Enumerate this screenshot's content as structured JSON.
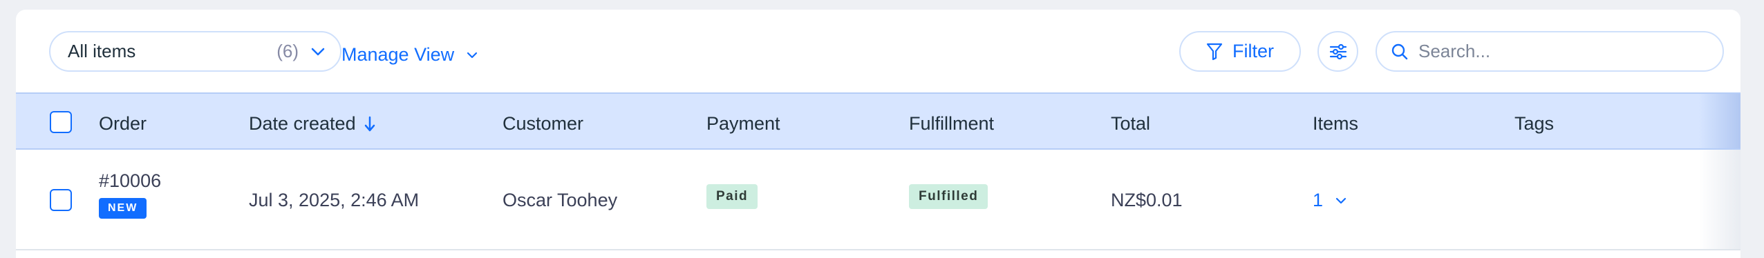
{
  "toolbar": {
    "view_select": {
      "label": "All items",
      "count": "(6)"
    },
    "manage_view_label": "Manage View",
    "filter_label": "Filter",
    "search": {
      "placeholder": "Search...",
      "value": ""
    }
  },
  "table": {
    "columns": [
      "Order",
      "Date created",
      "Customer",
      "Payment",
      "Fulfillment",
      "Total",
      "Items",
      "Tags"
    ],
    "sorted_column": "Date created",
    "sort_direction": "descending",
    "rows": [
      {
        "order": "#10006",
        "badge": "NEW",
        "date_created": "Jul 3, 2025, 2:46 AM",
        "customer": "Oscar Toohey",
        "payment": "Paid",
        "fulfillment": "Fulfilled",
        "total": "NZ$0.01",
        "items": "1",
        "tags": ""
      }
    ]
  },
  "colors": {
    "accent": "#116dff",
    "header_bg": "#d7e5ff",
    "badge_green": "#cdeee0",
    "page_bg": "#eef0f4"
  },
  "icons": {
    "view_select": "chevron-down-icon",
    "manage_view": "chevron-down-icon",
    "filter": "filter-icon",
    "settings": "sliders-icon",
    "search": "search-icon",
    "sort": "arrow-down-icon",
    "items": "chevron-down-icon"
  }
}
